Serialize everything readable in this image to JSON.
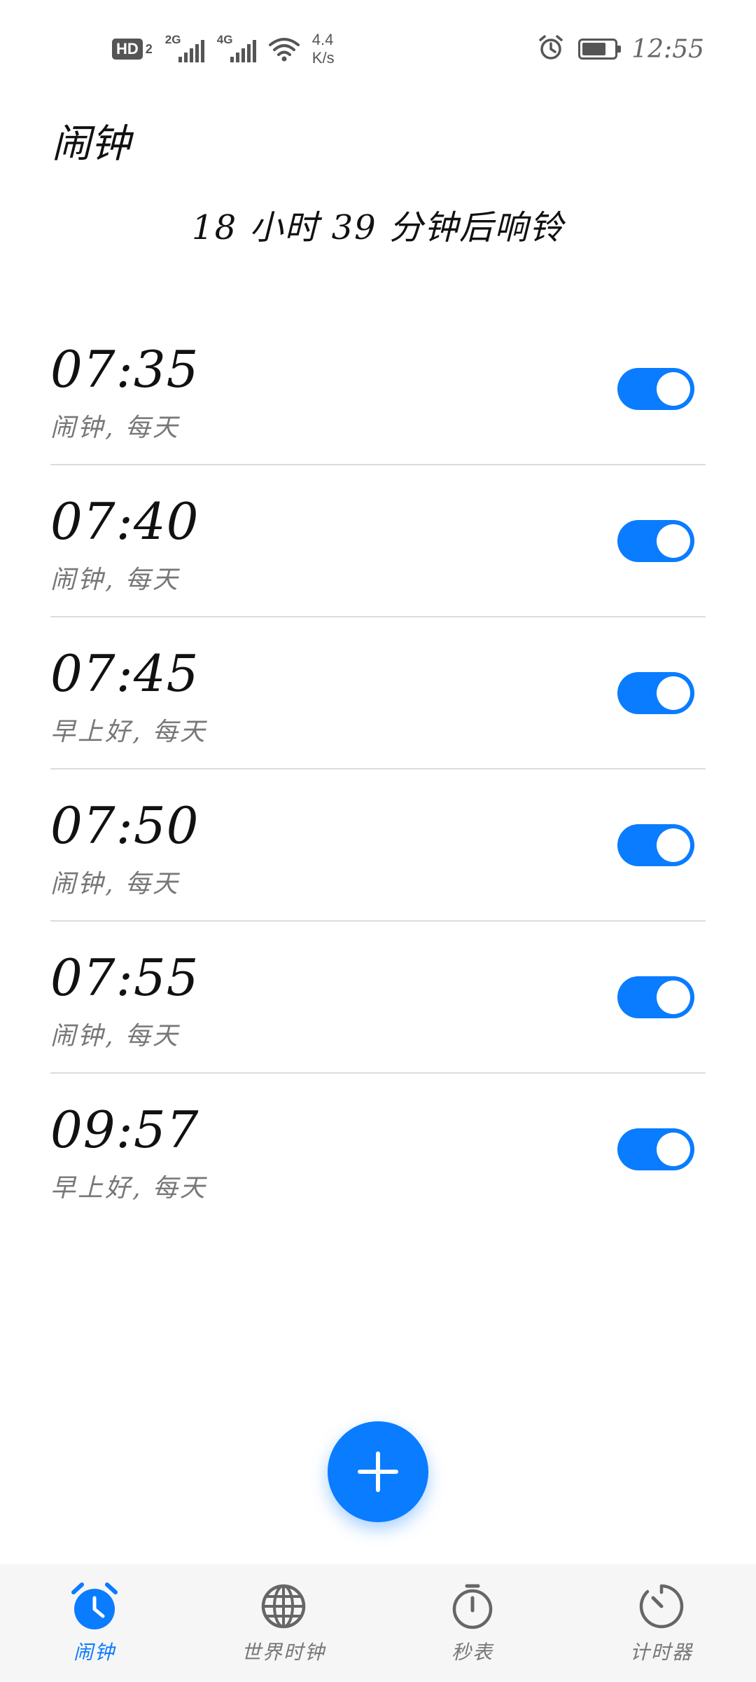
{
  "status_bar": {
    "hd_label": "HD",
    "hd_num": "2",
    "signal_1_gen": "2G",
    "signal_2_gen": "4G",
    "speed_value": "4.4",
    "speed_unit": "K/s",
    "time": "12:55",
    "battery_level": 0.75,
    "icons": [
      "wifi-icon",
      "alarm-clock-icon",
      "battery-icon"
    ]
  },
  "header": {
    "title": "闹钟",
    "next_alarm": "18 小时 39 分钟后响铃"
  },
  "alarms": [
    {
      "time": "07:35",
      "label": "闹钟, 每天",
      "enabled": true
    },
    {
      "time": "07:40",
      "label": "闹钟, 每天",
      "enabled": true
    },
    {
      "time": "07:45",
      "label": "早上好, 每天",
      "enabled": true
    },
    {
      "time": "07:50",
      "label": "闹钟, 每天",
      "enabled": true
    },
    {
      "time": "07:55",
      "label": "闹钟, 每天",
      "enabled": true
    },
    {
      "time": "09:57",
      "label": "早上好, 每天",
      "enabled": true
    }
  ],
  "fab": {
    "icon": "plus-icon"
  },
  "bottom_nav": {
    "items": [
      {
        "label": "闹钟",
        "icon": "alarm-clock-icon",
        "active": true
      },
      {
        "label": "世界时钟",
        "icon": "globe-icon",
        "active": false
      },
      {
        "label": "秒表",
        "icon": "stopwatch-icon",
        "active": false
      },
      {
        "label": "计时器",
        "icon": "timer-icon",
        "active": false
      }
    ]
  },
  "colors": {
    "accent": "#0a7cff",
    "text": "#111111",
    "secondary_text": "#777777",
    "divider": "#dcdcdc",
    "nav_background": "#f6f6f6"
  }
}
